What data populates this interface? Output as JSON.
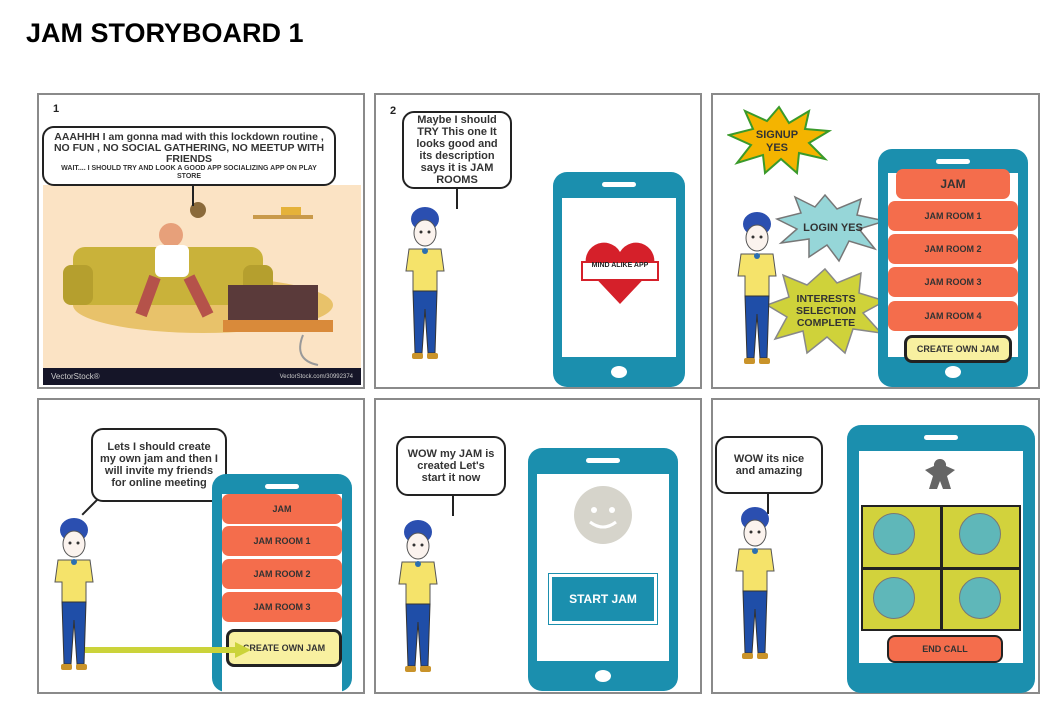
{
  "title": "JAM STORYBOARD 1",
  "panels": [
    {
      "number": "1",
      "speech_main": "AAAHHH I am gonna mad with this lockdown routine , NO FUN , NO SOCIAL GATHERING, NO MEETUP WITH FRIENDS",
      "speech_sub": "WAIT.... I SHOULD TRY AND LOOK A GOOD APP SOCIALIZING APP ON PLAY STORE",
      "watermark": "VectorStock®",
      "watermark_url": "VectorStock.com/30992374"
    },
    {
      "number": "2",
      "speech": "Maybe I should TRY This one It looks good and its description says it is JAM ROOMS",
      "app_banner": "MIND ALIKE APP"
    },
    {
      "burst_signup": "SIGNUP YES",
      "burst_login": "LOGIN YES",
      "burst_interests": "INTERESTS SELECTION COMPLETE",
      "app_header": "JAM",
      "rooms": [
        "JAM ROOM 1",
        "JAM ROOM 2",
        "JAM ROOM 3",
        "JAM ROOM 4"
      ],
      "create_button": "CREATE OWN JAM"
    },
    {
      "speech": "Lets I should create my own jam and then I will invite my friends for online meeting",
      "app_header": "JAM",
      "rooms": [
        "JAM ROOM 1",
        "JAM ROOM 2",
        "JAM ROOM 3"
      ],
      "create_button": "CREATE OWN JAM"
    },
    {
      "speech": "WOW my JAM is created Let's start it now",
      "start_button": "START JAM"
    },
    {
      "speech": "WOW its nice and amazing",
      "end_button": "END CALL"
    }
  ],
  "colors": {
    "phone": "#1b8fae",
    "room": "#f46d4c",
    "create": "#f8f0a0",
    "grid": "#d2d23c",
    "circle": "#5fb7b9"
  }
}
